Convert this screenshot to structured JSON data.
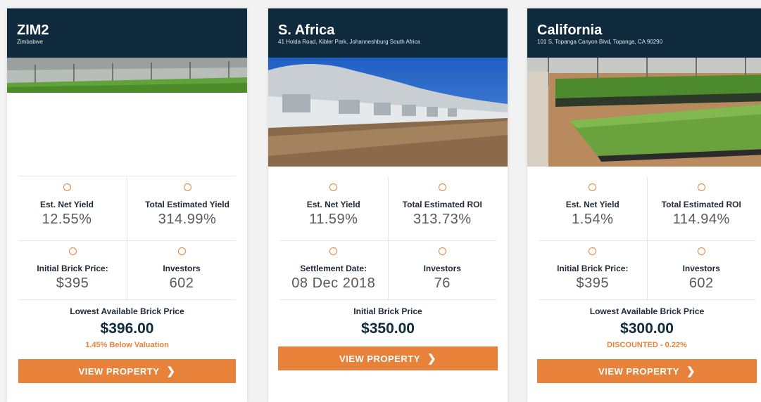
{
  "properties": [
    {
      "name": "ZIM2",
      "address": "Zimbabwe",
      "stat1_label": "Est. Net Yield",
      "stat1_value": "12.55%",
      "stat2_label": "Total Estimated Yield",
      "stat2_value": "314.99%",
      "stat3_label": "Initial Brick Price:",
      "stat3_value": "$395",
      "stat4_label": "Investors",
      "stat4_value": "602",
      "price_label": "Lowest Available Brick Price",
      "price_value": "$396.00",
      "price_note": "1.45% Below Valuation",
      "button_label": "VIEW PROPERTY",
      "icons": [
        "coin-icon",
        "chevron-right-icon"
      ]
    },
    {
      "name": "S. Africa",
      "address": "41 Holda Road, Kibler Park, Johanneshburg South Africa",
      "stat1_label": "Est. Net Yield",
      "stat1_value": "11.59%",
      "stat2_label": "Total Estimated ROI",
      "stat2_value": "313.73%",
      "stat3_label": "Settlement Date:",
      "stat3_value": "08 Dec 2018",
      "stat4_label": "Investors",
      "stat4_value": "76",
      "price_label": "Initial Brick Price",
      "price_value": "$350.00",
      "price_note": "",
      "button_label": "VIEW PROPERTY",
      "icons": [
        "coin-icon",
        "chevron-right-icon"
      ]
    },
    {
      "name": "California",
      "address": "101 S, Topanga Canyon Blvd, Topanga, CA 90290",
      "stat1_label": "Est. Net Yield",
      "stat1_value": "1.54%",
      "stat2_label": "Total Estimated ROI",
      "stat2_value": "114.94%",
      "stat3_label": "Initial Brick Price:",
      "stat3_value": "$395",
      "stat4_label": "Investors",
      "stat4_value": "602",
      "price_label": "Lowest Available Brick Price",
      "price_value": "$300.00",
      "price_note": "DISCOUNTED - 0.22%",
      "button_label": "VIEW PROPERTY",
      "icons": [
        "coin-icon",
        "chevron-right-icon"
      ]
    }
  ],
  "colors": {
    "header_bg": "#0f2a3c",
    "accent": "#e8813a",
    "text_dark": "#1e2a36",
    "value_grey": "#58595b"
  }
}
